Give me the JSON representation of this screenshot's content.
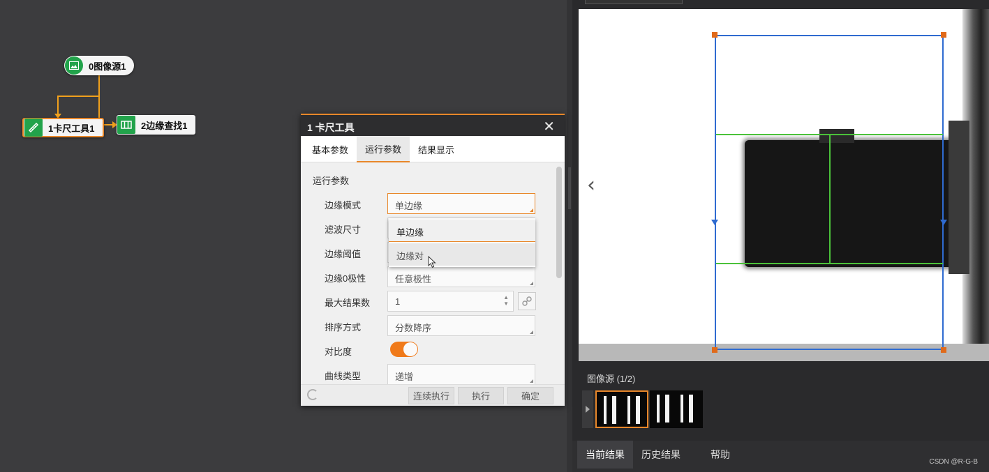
{
  "flow": {
    "nodes": [
      {
        "label": "0图像源1",
        "icon": "image-icon"
      },
      {
        "label": "1卡尺工具1",
        "icon": "caliper-icon"
      },
      {
        "label": "2边缘查找1",
        "icon": "edge-find-icon"
      }
    ]
  },
  "dialog": {
    "title": "1 卡尺工具",
    "close": "✕",
    "tabs": [
      "基本参数",
      "运行参数",
      "结果显示"
    ],
    "active_tab": "运行参数",
    "section": "运行参数",
    "rows": [
      {
        "label": "边缘模式",
        "value": "单边缘"
      },
      {
        "label": "滤波尺寸",
        "value": ""
      },
      {
        "label": "边缘阈值",
        "value": ""
      },
      {
        "label": "边缘0极性",
        "value": "任意极性"
      },
      {
        "label": "最大结果数",
        "value": "1"
      },
      {
        "label": "排序方式",
        "value": "分数降序"
      },
      {
        "label": "对比度",
        "value": ""
      },
      {
        "label": "曲线类型",
        "value": "递增"
      }
    ],
    "contrast_toggle_on": true,
    "dropdown": {
      "options": [
        "单边缘",
        "边缘对"
      ],
      "selected": "单边缘",
      "hover": "边缘对"
    },
    "footer": {
      "continuous_run": "连续执行",
      "run": "执行",
      "confirm": "确定"
    }
  },
  "image_panel": {
    "source_title": "图像源 (1/2)",
    "nav_prev": "‹",
    "thumbnail_count": 2,
    "selected_thumbnail": 1
  },
  "bottom_tabs": [
    "当前结果",
    "历史结果",
    "帮助"
  ],
  "active_bottom_tab": "当前结果",
  "watermark": "CSDN @R-G-B",
  "colors": {
    "accent": "#e8872a",
    "node_green": "#22a34b",
    "roi_blue": "#2f6bd0",
    "edge_green": "#4bc23a",
    "wire_orange": "#f0a01c"
  }
}
